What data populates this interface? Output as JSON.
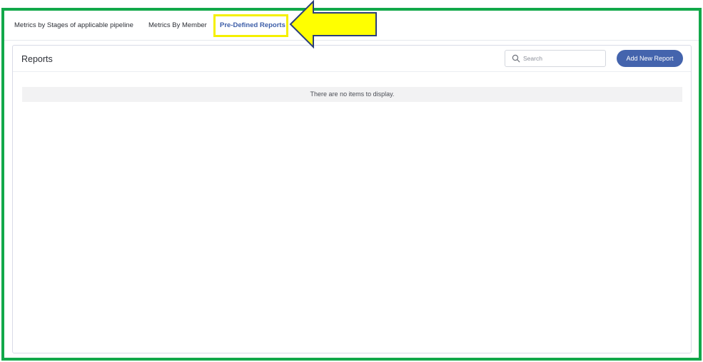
{
  "tabs": [
    {
      "label": "Metrics by Stages of applicable pipeline",
      "active": false
    },
    {
      "label": "Metrics By Member",
      "active": false
    },
    {
      "label": "Pre-Defined Reports",
      "active": true
    }
  ],
  "panel": {
    "title": "Reports",
    "search": {
      "placeholder": "Search",
      "value": "",
      "icon": "search-icon"
    },
    "add_button": "Add New Report",
    "empty_message": "There are no items to display."
  },
  "annotations": {
    "frame_color": "#12a84a",
    "highlight_color": "#f5f000",
    "arrow_fill": "#ffff00",
    "arrow_stroke": "#2b3f7a"
  },
  "colors": {
    "accent": "#4464ad",
    "active_tab": "#3d5ea8"
  }
}
